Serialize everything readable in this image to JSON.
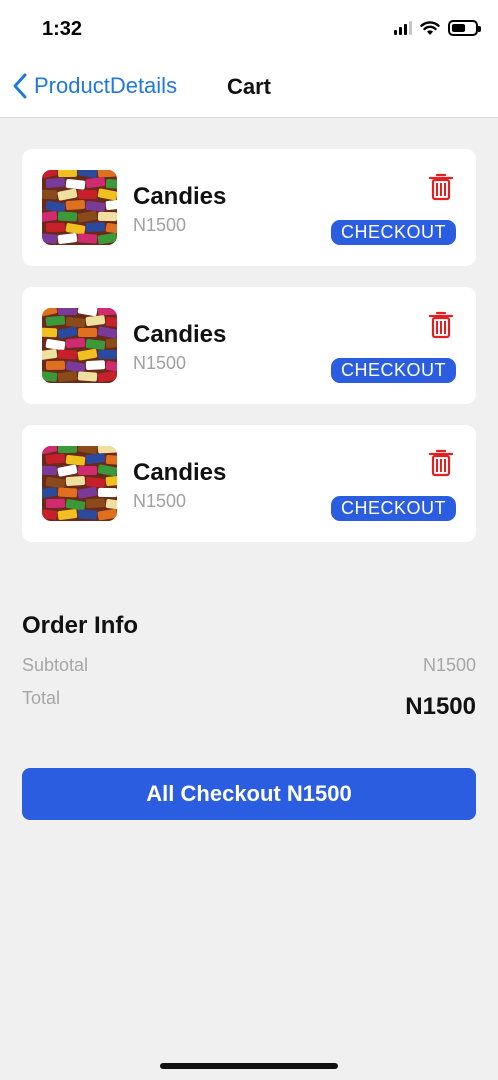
{
  "status_bar": {
    "time": "1:32",
    "icons": [
      "signal-icon",
      "wifi-icon",
      "battery-icon"
    ]
  },
  "nav": {
    "back_label": "ProductDetails",
    "title": "Cart",
    "accent": "#1f78e0"
  },
  "cart": {
    "items": [
      {
        "name": "Candies",
        "price": "N1500",
        "action": "CHECKOUT",
        "delete_icon": "trash-icon"
      },
      {
        "name": "Candies",
        "price": "N1500",
        "action": "CHECKOUT",
        "delete_icon": "trash-icon"
      },
      {
        "name": "Candies",
        "price": "N1500",
        "action": "CHECKOUT",
        "delete_icon": "trash-icon"
      }
    ]
  },
  "order_info": {
    "title": "Order Info",
    "subtotal_label": "Subtotal",
    "subtotal_value": "N1500",
    "total_label": "Total",
    "total_value": "N1500"
  },
  "all_checkout_label": "All Checkout N1500",
  "colors": {
    "primary": "#2a5de0",
    "delete": "#e32020",
    "background": "#f0f0f0"
  }
}
